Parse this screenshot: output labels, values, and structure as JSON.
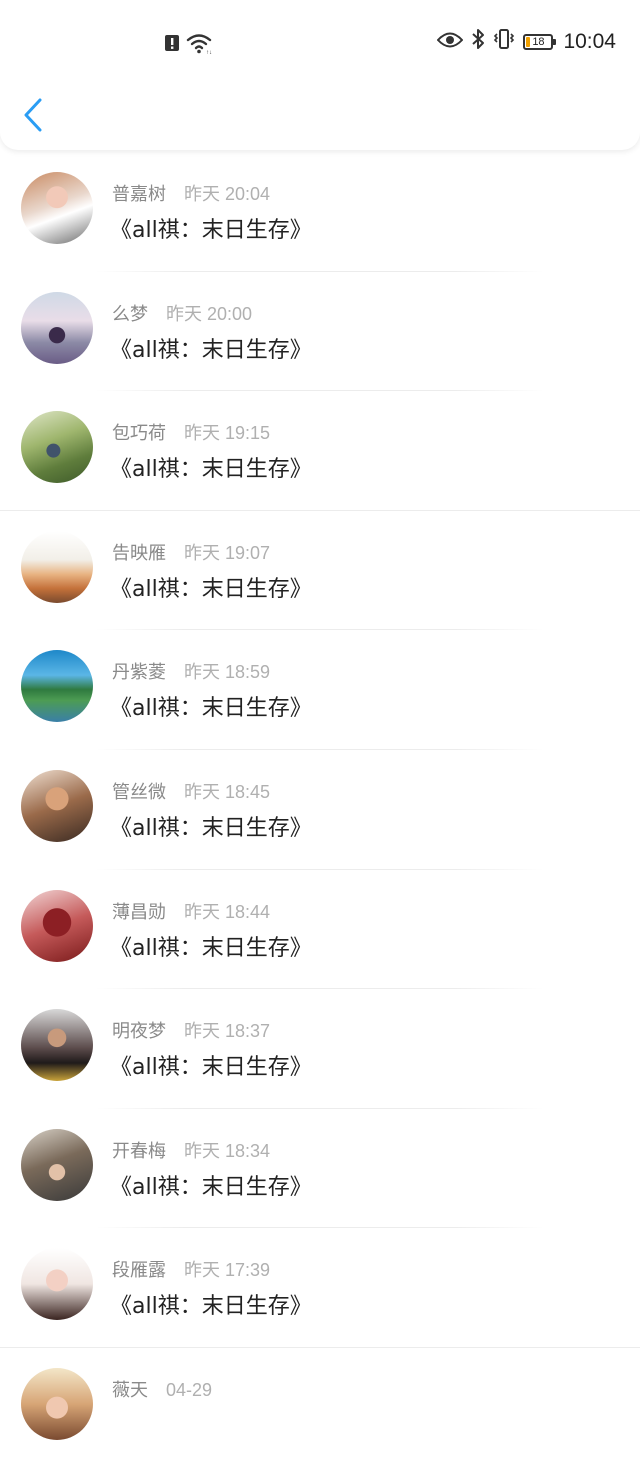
{
  "status_bar": {
    "time": "10:04",
    "battery": "18",
    "battery_level": 0.18,
    "icons": [
      "alert-icon",
      "wifi-icon",
      "eye-icon",
      "bluetooth-icon",
      "vibrate-icon",
      "battery-icon"
    ]
  },
  "header": {
    "back_icon": "chevron-left-icon",
    "accent_color": "#2a9df4"
  },
  "messages": [
    {
      "name": "普嘉树",
      "time": "昨天 20:04",
      "text": "《all祺：末日生存》"
    },
    {
      "name": "么梦",
      "time": "昨天 20:00",
      "text": "《all祺：末日生存》"
    },
    {
      "name": "包巧荷",
      "time": "昨天 19:15",
      "text": "《all祺：末日生存》"
    },
    {
      "name": "告映雁",
      "time": "昨天 19:07",
      "text": "《all祺：末日生存》"
    },
    {
      "name": "丹紫菱",
      "time": "昨天 18:59",
      "text": "《all祺：末日生存》"
    },
    {
      "name": "管丝微",
      "time": "昨天 18:45",
      "text": "《all祺：末日生存》"
    },
    {
      "name": "薄昌勋",
      "time": "昨天 18:44",
      "text": "《all祺：末日生存》"
    },
    {
      "name": "明夜梦",
      "time": "昨天 18:37",
      "text": "《all祺：末日生存》"
    },
    {
      "name": "开春梅",
      "time": "昨天 18:34",
      "text": "《all祺：末日生存》"
    },
    {
      "name": "段雁露",
      "time": "昨天 17:39",
      "text": "《all祺：末日生存》"
    },
    {
      "name": "薇天",
      "time": "04-29",
      "text": ""
    }
  ]
}
